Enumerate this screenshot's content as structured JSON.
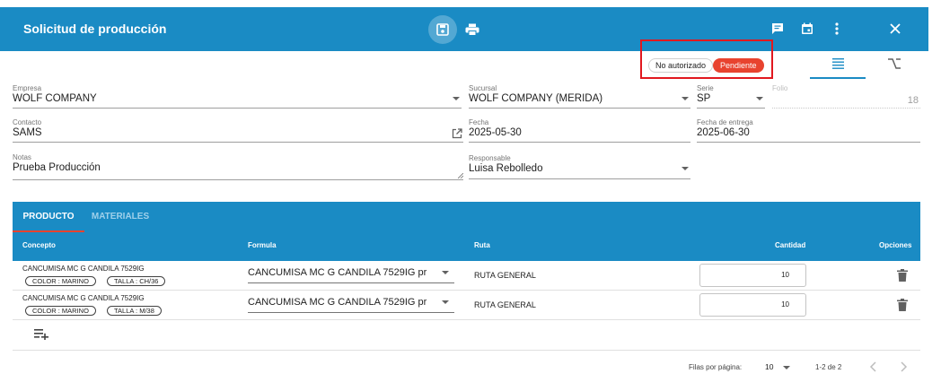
{
  "header": {
    "title": "Solicitud de producción",
    "icons": [
      "save-icon",
      "print-icon",
      "comment-icon",
      "calendar-icon",
      "more-vert-icon",
      "close-icon"
    ]
  },
  "status": {
    "auth_chip": "No autorizado",
    "state_chip": "Pendiente",
    "state_color": "#e8432f",
    "view_tabs": [
      "list-icon",
      "branch-icon"
    ]
  },
  "form": {
    "empresa": {
      "label": "Empresa",
      "value": "WOLF COMPANY"
    },
    "sucursal": {
      "label": "Sucursal",
      "value": "WOLF COMPANY (MERIDA)"
    },
    "serie": {
      "label": "Serie",
      "value": "SP"
    },
    "folio": {
      "label": "Folio",
      "value": "18"
    },
    "contacto": {
      "label": "Contacto",
      "value": "SAMS"
    },
    "fecha": {
      "label": "Fecha",
      "value": "2025-05-30"
    },
    "fecha_entrega": {
      "label": "Fecha de entrega",
      "value": "2025-06-30"
    },
    "notas": {
      "label": "Notas",
      "value": "Prueba Producción"
    },
    "responsable": {
      "label": "Responsable",
      "value": "Luisa Rebolledo"
    }
  },
  "panel": {
    "tabs": [
      "PRODUCTO",
      "MATERIALES"
    ],
    "columns": [
      "Concepto",
      "Formula",
      "Ruta",
      "Cantidad",
      "Opciones"
    ],
    "rows": [
      {
        "concept": "CANCUMISA MC G CANDILA 7529IG",
        "tags": [
          "COLOR : MARINO",
          "TALLA : CH/36"
        ],
        "formula": "CANCUMISA MC G CANDILA 7529IG pr",
        "ruta": "RUTA GENERAL",
        "cantidad": "10"
      },
      {
        "concept": "CANCUMISA MC G CANDILA 7529IG",
        "tags": [
          "COLOR : MARINO",
          "TALLA : M/38"
        ],
        "formula": "CANCUMISA MC G CANDILA 7529IG pr",
        "ruta": "RUTA GENERAL",
        "cantidad": "10"
      }
    ]
  },
  "pagination": {
    "rows_per_page_label": "Filas por página:",
    "rows_per_page": "10",
    "range": "1-2 de 2"
  },
  "colors": {
    "primary": "#1a8bc4",
    "accent": "#e8432f",
    "highlight_box": "#e1181f"
  }
}
